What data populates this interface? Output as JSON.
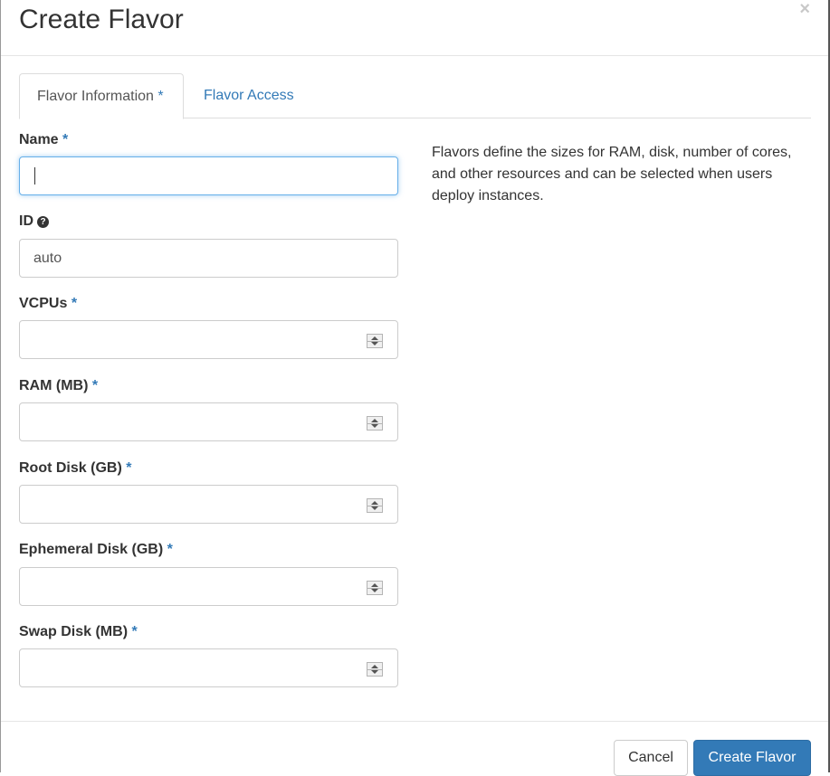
{
  "modal": {
    "title": "Create Flavor",
    "close_icon": "×"
  },
  "tabs": [
    {
      "label": "Flavor Information",
      "required_mark": "*",
      "active": true
    },
    {
      "label": "Flavor Access",
      "active": false
    }
  ],
  "fields": {
    "name": {
      "label": "Name",
      "required_mark": "*",
      "value": ""
    },
    "id": {
      "label": "ID",
      "help_icon": "question-circle-icon",
      "value": "auto"
    },
    "vcpus": {
      "label": "VCPUs",
      "required_mark": "*",
      "value": ""
    },
    "ram": {
      "label": "RAM (MB)",
      "required_mark": "*",
      "value": ""
    },
    "root_disk": {
      "label": "Root Disk (GB)",
      "required_mark": "*",
      "value": ""
    },
    "ephemeral_disk": {
      "label": "Ephemeral Disk (GB)",
      "required_mark": "*",
      "value": ""
    },
    "swap_disk": {
      "label": "Swap Disk (MB)",
      "required_mark": "*",
      "value": ""
    }
  },
  "description": "Flavors define the sizes for RAM, disk, number of cores, and other resources and can be selected when users deploy instances.",
  "footer": {
    "cancel_label": "Cancel",
    "submit_label": "Create Flavor"
  },
  "colors": {
    "accent": "#337ab7",
    "focus": "#66afe9"
  }
}
